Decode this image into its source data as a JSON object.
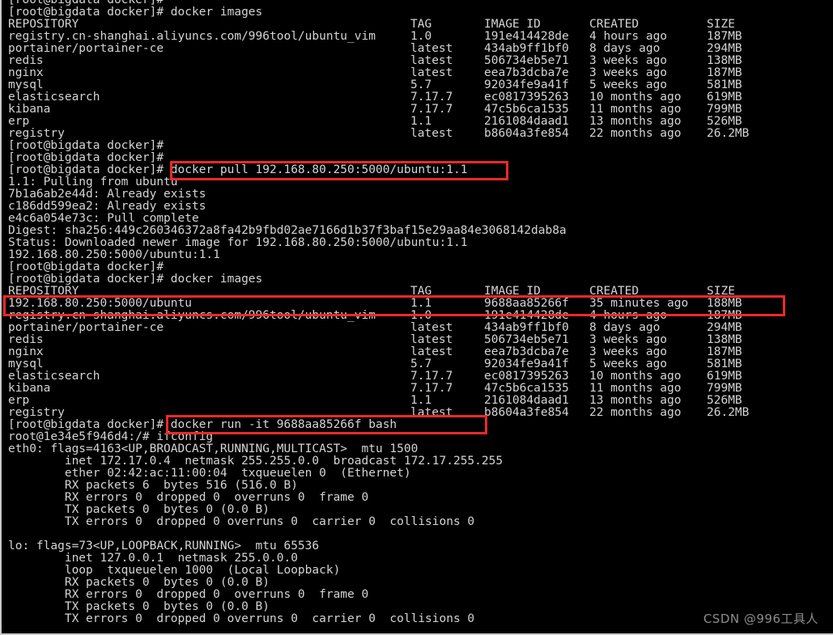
{
  "terminal": {
    "background": "#000000",
    "foreground": "#d4d4d4",
    "highlight_color": "#ef2929",
    "prompt_host": "[root@bigdata docker]# ",
    "container_prompt": "root@1e34e5f946d4:/# "
  },
  "watermark": {
    "text": "CSDN @996工具人"
  },
  "lines": {
    "l00_partial_prompt": "[root@bigdata docker]#",
    "l01_cmd_images_1": "[root@bigdata docker]# docker images",
    "l14_prompt_blank_1": "[root@bigdata docker]#",
    "l15_prompt_blank_2": "[root@bigdata docker]#",
    "l16_prompt_pull": "[root@bigdata docker]# ",
    "l16_cmd_pull": "docker pull 192.168.80.250:5000/ubuntu:1.1",
    "l17_pull_from": "1.1: Pulling from ubuntu",
    "l18_layer_1": "7b1a6ab2e44d: Already exists",
    "l19_layer_2": "c186dd599ea2: Already exists",
    "l20_layer_3": "e4c6a054e73c: Pull complete",
    "l21_digest": "Digest: sha256:449c260346372a8fa42b9fbd02ae7166d1b37f3baf15e29aa84e3068142dab8a",
    "l22_status": "Status: Downloaded newer image for 192.168.80.250:5000/ubuntu:1.1",
    "l23_image_ref": "192.168.80.250:5000/ubuntu:1.1",
    "l24_prompt_blank_3": "[root@bigdata docker]#",
    "l25_cmd_images_2": "[root@bigdata docker]# docker images",
    "l40_prompt_run": "[root@bigdata docker]# ",
    "l40_cmd_run": "docker run -it 9688aa85266f bash",
    "l41_cmd_ifconfig_prompt": "root@1e34e5f946d4:/# ",
    "l41_cmd_ifconfig": "ifconfig"
  },
  "images_table": {
    "headers": {
      "repository": "REPOSITORY",
      "tag": "TAG",
      "image_id": "IMAGE ID",
      "created": "CREATED",
      "size": "SIZE"
    },
    "first_listing": [
      {
        "repository": "registry.cn-shanghai.aliyuncs.com/996tool/ubuntu_vim",
        "tag": "1.0",
        "image_id": "191e414428de",
        "created": "4 hours ago",
        "size": "187MB"
      },
      {
        "repository": "portainer/portainer-ce",
        "tag": "latest",
        "image_id": "434ab9ff1bf0",
        "created": "8 days ago",
        "size": "294MB"
      },
      {
        "repository": "redis",
        "tag": "latest",
        "image_id": "506734eb5e71",
        "created": "3 weeks ago",
        "size": "138MB"
      },
      {
        "repository": "nginx",
        "tag": "latest",
        "image_id": "eea7b3dcba7e",
        "created": "3 weeks ago",
        "size": "187MB"
      },
      {
        "repository": "mysql",
        "tag": "5.7",
        "image_id": "92034fe9a41f",
        "created": "5 weeks ago",
        "size": "581MB"
      },
      {
        "repository": "elasticsearch",
        "tag": "7.17.7",
        "image_id": "ec0817395263",
        "created": "10 months ago",
        "size": "619MB"
      },
      {
        "repository": "kibana",
        "tag": "7.17.7",
        "image_id": "47c5b6ca1535",
        "created": "11 months ago",
        "size": "799MB"
      },
      {
        "repository": "erp",
        "tag": "1.1",
        "image_id": "2161084daad1",
        "created": "13 months ago",
        "size": "526MB"
      },
      {
        "repository": "registry",
        "tag": "latest",
        "image_id": "b8604a3fe854",
        "created": "22 months ago",
        "size": "26.2MB"
      }
    ],
    "second_listing": [
      {
        "repository": "192.168.80.250:5000/ubuntu",
        "tag": "1.1",
        "image_id": "9688aa85266f",
        "created": "35 minutes ago",
        "size": "188MB"
      },
      {
        "repository": "registry.cn-shanghai.aliyuncs.com/996tool/ubuntu_vim",
        "tag": "1.0",
        "image_id": "191e414428de",
        "created": "4 hours ago",
        "size": "187MB"
      },
      {
        "repository": "portainer/portainer-ce",
        "tag": "latest",
        "image_id": "434ab9ff1bf0",
        "created": "8 days ago",
        "size": "294MB"
      },
      {
        "repository": "redis",
        "tag": "latest",
        "image_id": "506734eb5e71",
        "created": "3 weeks ago",
        "size": "138MB"
      },
      {
        "repository": "nginx",
        "tag": "latest",
        "image_id": "eea7b3dcba7e",
        "created": "3 weeks ago",
        "size": "187MB"
      },
      {
        "repository": "mysql",
        "tag": "5.7",
        "image_id": "92034fe9a41f",
        "created": "5 weeks ago",
        "size": "581MB"
      },
      {
        "repository": "elasticsearch",
        "tag": "7.17.7",
        "image_id": "ec0817395263",
        "created": "10 months ago",
        "size": "619MB"
      },
      {
        "repository": "kibana",
        "tag": "7.17.7",
        "image_id": "47c5b6ca1535",
        "created": "11 months ago",
        "size": "799MB"
      },
      {
        "repository": "erp",
        "tag": "1.1",
        "image_id": "2161084daad1",
        "created": "13 months ago",
        "size": "526MB"
      },
      {
        "repository": "registry",
        "tag": "latest",
        "image_id": "b8604a3fe854",
        "created": "22 months ago",
        "size": "26.2MB"
      }
    ]
  },
  "ifconfig": {
    "eth0": {
      "header": "eth0: flags=4163<UP,BROADCAST,RUNNING,MULTICAST>  mtu 1500",
      "inet": "        inet 172.17.0.4  netmask 255.255.0.0  broadcast 172.17.255.255",
      "ether": "        ether 02:42:ac:11:00:04  txqueuelen 0  (Ethernet)",
      "rx_packets": "        RX packets 6  bytes 516 (516.0 B)",
      "rx_errors": "        RX errors 0  dropped 0  overruns 0  frame 0",
      "tx_packets": "        TX packets 0  bytes 0 (0.0 B)",
      "tx_errors": "        TX errors 0  dropped 0 overruns 0  carrier 0  collisions 0"
    },
    "lo": {
      "header": "lo: flags=73<UP,LOOPBACK,RUNNING>  mtu 65536",
      "inet": "        inet 127.0.0.1  netmask 255.0.0.0",
      "loop": "        loop  txqueuelen 1000  (Local Loopback)",
      "rx_packets": "        RX packets 0  bytes 0 (0.0 B)",
      "rx_errors": "        RX errors 0  dropped 0  overruns 0  frame 0",
      "tx_packets": "        TX packets 0  bytes 0 (0.0 B)",
      "tx_errors": "        TX errors 0  dropped 0 overruns 0  carrier 0  collisions 0"
    }
  }
}
